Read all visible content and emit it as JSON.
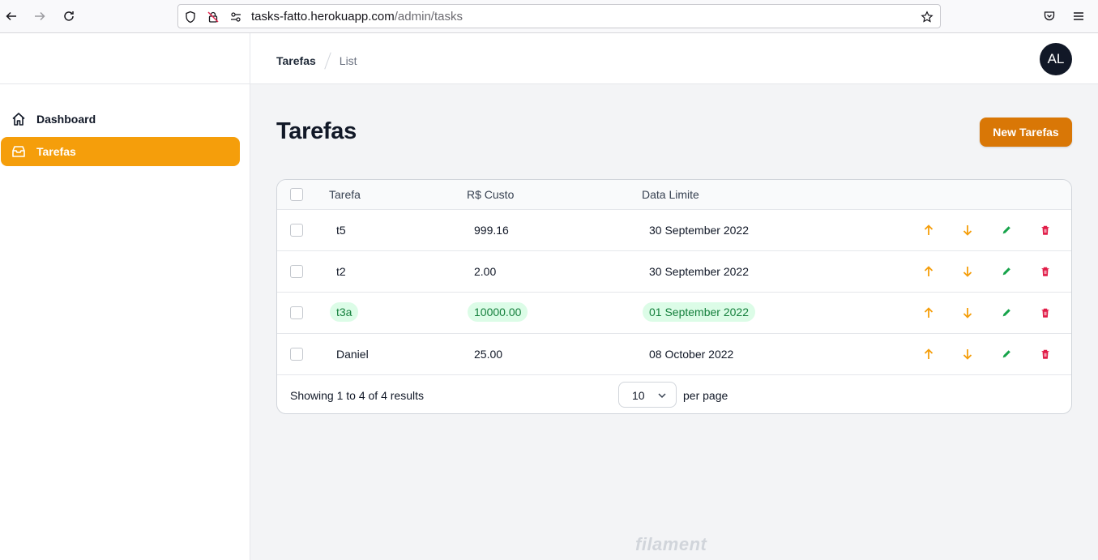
{
  "browser": {
    "url_host": "tasks-fatto.herokuapp.com",
    "url_path": "/admin/tasks"
  },
  "sidebar": {
    "items": [
      {
        "label": "Dashboard",
        "icon": "home-icon"
      },
      {
        "label": "Tarefas",
        "icon": "archive-icon",
        "active": true
      }
    ]
  },
  "topbar": {
    "breadcrumbs": [
      "Tarefas",
      "List"
    ],
    "avatar_initials": "AL"
  },
  "page": {
    "title": "Tarefas",
    "new_button": "New Tarefas"
  },
  "table": {
    "columns": [
      "Tarefa",
      "R$ Custo",
      "Data Limite"
    ],
    "rows": [
      {
        "tarefa": "t5",
        "custo": "999.16",
        "data": "30 September 2022",
        "highlight": false
      },
      {
        "tarefa": "t2",
        "custo": "2.00",
        "data": "30 September 2022",
        "highlight": false
      },
      {
        "tarefa": "t3a",
        "custo": "10000.00",
        "data": "01 September 2022",
        "highlight": true
      },
      {
        "tarefa": "Daniel",
        "custo": "25.00",
        "data": "08 October 2022",
        "highlight": false
      }
    ],
    "footer": {
      "showing": "Showing 1 to 4 of 4 results",
      "per_page_value": "10",
      "per_page_label": "per page"
    }
  },
  "colors": {
    "accent": "#f59e0b",
    "button": "#d97706",
    "move_up_down": "#f59e0b",
    "edit": "#16a34a",
    "delete": "#e11d48"
  },
  "footer": {
    "brand": "filament"
  }
}
